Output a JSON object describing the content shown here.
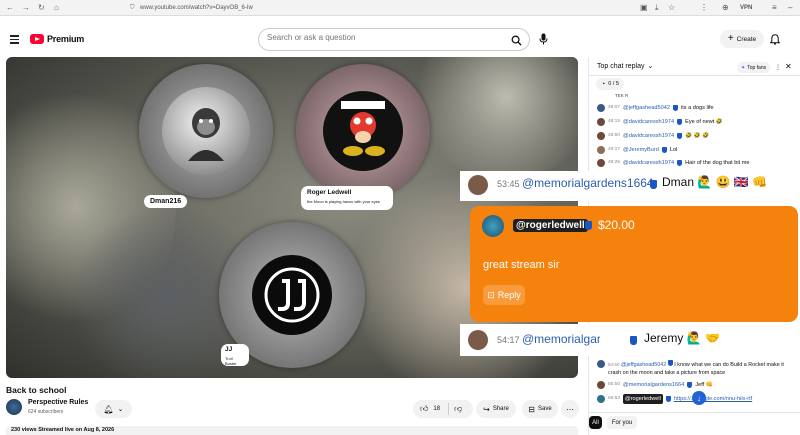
{
  "browser": {
    "url": "www.youtube.com/watch?v=DayvOB_6-Iw",
    "vpn_label": "VPN"
  },
  "header": {
    "logo_text": "Premium",
    "search_placeholder": "Search or ask a question",
    "create_label": "Create"
  },
  "video": {
    "participants": [
      {
        "name": "Dman216",
        "status": ""
      },
      {
        "name": "Roger Ledwell",
        "status": "the Moon is playing havoc with your eyes"
      },
      {
        "name": "JJ",
        "status": "Troll Buster"
      }
    ]
  },
  "below_video": {
    "title": "Back to school",
    "channel_name": "Perspective Rules",
    "subscribers": "624 subscribers",
    "like_count": "18",
    "share_label": "Share",
    "save_label": "Save",
    "meta": "230 views  Streamed live on Aug 8, 2026"
  },
  "chat": {
    "mode_label": "Top chat replay",
    "top_fans_label": "Top fans",
    "poll_count": "0 / 5",
    "top_cut_text": "TEK R",
    "messages": [
      {
        "time": "48:07",
        "author": "@jeffgashead5042",
        "text": "its a dogs life"
      },
      {
        "time": "48:15",
        "author": "@davidcaressh1974",
        "text": "Eye of newt 🤣"
      },
      {
        "time": "48:50",
        "author": "@davidcaressh1974",
        "text": "🤣 🤣 🤣"
      },
      {
        "time": "49:17",
        "author": "@JeremyBurd",
        "text": "Lol"
      },
      {
        "time": "49:25",
        "author": "@davidcaressh1974",
        "text": "Hair of the dog that bit me"
      }
    ],
    "bottom_messages": [
      {
        "time": "54:50",
        "author": "@jeffgashead5042",
        "text": "I know what we can do Build a Rocket make it crash on the moon and take a picture from space"
      },
      {
        "time": "55:50",
        "author": "@memorialgardens1664",
        "text": "Jeff 👊"
      },
      {
        "time": "55:53",
        "author": "@rogerledwell",
        "text": "https://...google.com/nnu-hiix-rtf"
      }
    ],
    "tabs": [
      "All",
      "For you"
    ]
  },
  "overlay": {
    "row1": {
      "time": "53:45",
      "author": "@memorialgardens1664",
      "text": "Dman 🙋‍♂️ 😃 🇬🇧 👊"
    },
    "superchat": {
      "author": "@rogerledwell",
      "amount": "$20.00",
      "message": "great stream sir",
      "reply_label": "Reply"
    },
    "row3": {
      "time": "54:17",
      "author": "@memorialgardens1664",
      "text": "Jeremy 🙋‍♂️ 🤝"
    },
    "superchat_color": "#f5820d"
  },
  "colors": {
    "brand_red": "#ff0033",
    "accent_blue": "#2a5db0"
  }
}
